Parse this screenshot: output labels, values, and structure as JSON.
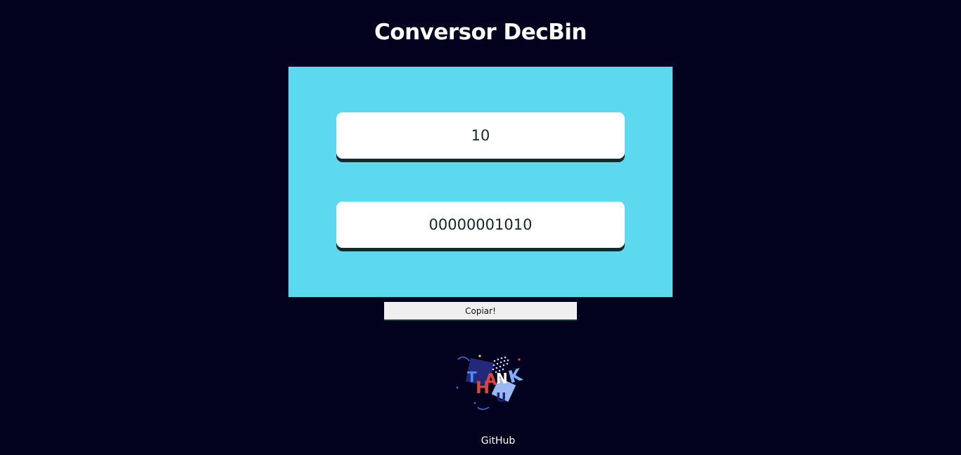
{
  "header": {
    "title": "Conversor DecBin"
  },
  "converter": {
    "decimal_value": "10",
    "binary_value": "00000001010",
    "copy_label": "Copiar!"
  },
  "colors": {
    "background": "#03021e",
    "panel": "#5cd9ef",
    "field": "#ffffff",
    "field_shadow": "#0f2a2d",
    "button": "#efefef"
  },
  "illustration": {
    "icon": "thank-u-illustration-icon"
  },
  "footer": {
    "github_label": "GitHub"
  }
}
